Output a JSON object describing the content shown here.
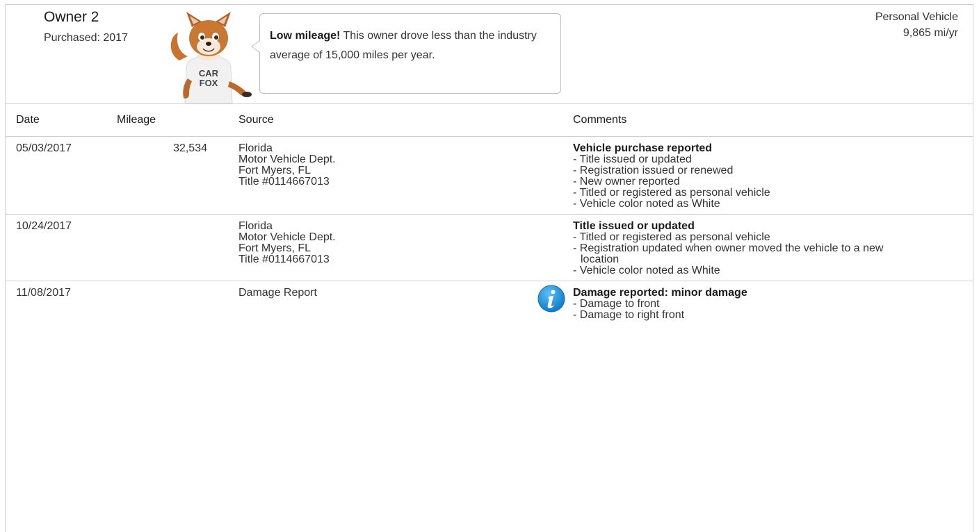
{
  "owner": {
    "title": "Owner 2",
    "purchased": "Purchased: 2017",
    "usage_type": "Personal Vehicle",
    "mileage_rate": "9,865 mi/yr"
  },
  "callout": {
    "bold": "Low mileage!",
    "text": " This owner drove less than the industry average of 15,000 miles per year."
  },
  "mascot": {
    "shirt_line1": "CAR",
    "shirt_line2": "FOX"
  },
  "table": {
    "headers": {
      "date": "Date",
      "mileage": "Mileage",
      "source": "Source",
      "comments": "Comments"
    },
    "rows": [
      {
        "date": "05/03/2017",
        "mileage": "32,534",
        "source": [
          "Florida",
          "Motor Vehicle Dept.",
          "Fort Myers, FL",
          "Title #0114667013"
        ],
        "comment_head": "Vehicle purchase reported",
        "comments": [
          "- Title issued or updated",
          "- Registration issued or renewed",
          "- New owner reported",
          "- Titled or registered as personal vehicle",
          "- Vehicle color noted as White"
        ]
      },
      {
        "date": "10/24/2017",
        "mileage": "",
        "source": [
          "Florida",
          "Motor Vehicle Dept.",
          "Fort Myers, FL",
          "Title #0114667013"
        ],
        "comment_head": "Title issued or updated",
        "comments": [
          "- Titled or registered as personal vehicle",
          "- Registration updated when owner moved the vehicle to a new",
          "location",
          "- Vehicle color noted as White"
        ]
      },
      {
        "date": "11/08/2017",
        "mileage": "",
        "source": [
          "Damage Report"
        ],
        "comment_head": "Damage reported: minor damage",
        "comments": [
          "- Damage to front",
          "- Damage to right front"
        ],
        "info_icon": "info-icon",
        "info_color": "#1a8fd6"
      }
    ]
  }
}
